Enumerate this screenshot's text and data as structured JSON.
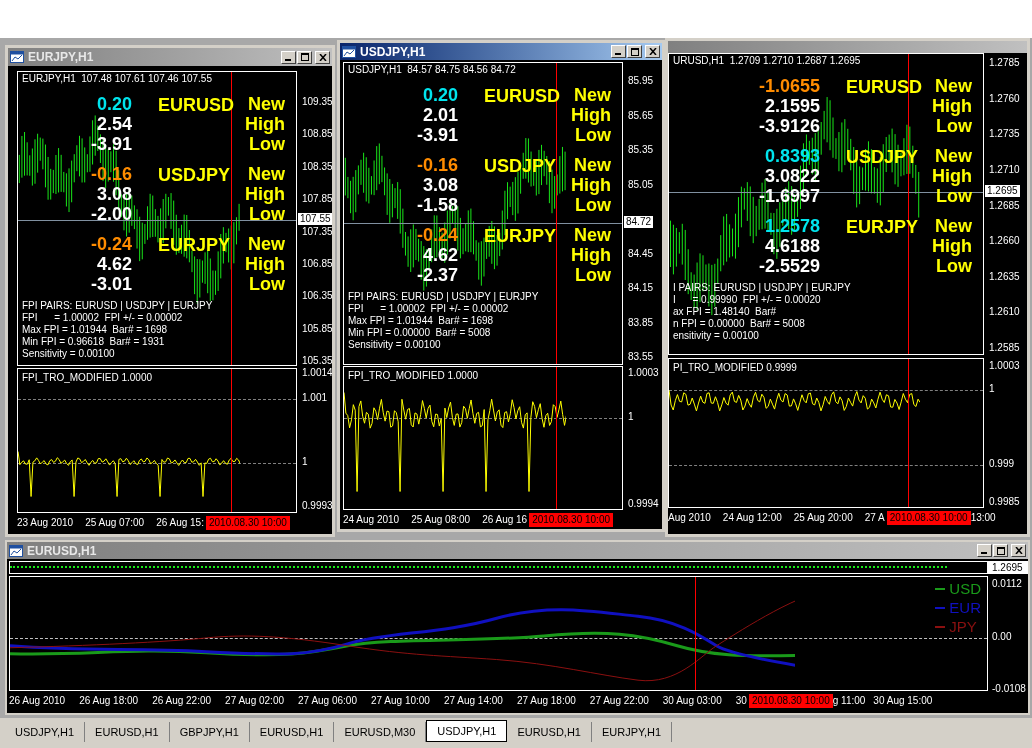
{
  "windows": [
    {
      "title": "EURJPY,H1",
      "active": false,
      "header": "EURJPY,H1  107.48 107.61 107.46 107.55",
      "groups": [
        {
          "pair": "EURUSD",
          "color": "#00e5ee",
          "values": [
            "0.20",
            "2.54",
            "-3.91"
          ],
          "labels": [
            "New",
            "High",
            "Low"
          ]
        },
        {
          "pair": "USDJPY",
          "color": "#ff8c00",
          "values": [
            "-0.16",
            "3.08",
            "-2.00"
          ],
          "labels": [
            "New",
            "High",
            "Low"
          ]
        },
        {
          "pair": "EURJPY",
          "color": "#ff8c00",
          "values": [
            "-0.24",
            "4.62",
            "-3.01"
          ],
          "labels": [
            "New",
            "High",
            "Low"
          ]
        }
      ],
      "info_lines": [
        "FPI PAIRS: EURUSD | USDJPY | EURJPY",
        "FPI      = 1.00002  FPI +/- = 0.00002",
        "Max FPI = 1.01944  Bar# = 1698",
        "Min FPI = 0.96618  Bar# = 1931",
        "Sensitivity = 0.00100"
      ],
      "price_ticks": [
        "109.35",
        "108.85",
        "108.35",
        "107.85",
        "107.35",
        "106.85",
        "106.35",
        "105.85",
        "105.35"
      ],
      "current_price": "107.55",
      "indicator": {
        "title": "FPI_TRO_MODIFIED 1.0000",
        "ticks": [
          "1.0014",
          "1.001",
          "1",
          "0.9993"
        ]
      },
      "time_labels": [
        "23 Aug 2010",
        "25 Aug 07:00",
        "26 Aug 15:"
      ],
      "cursor_time": "2010.08.30 10:00"
    },
    {
      "title": "USDJPY,H1",
      "active": true,
      "header": "USDJPY,H1  84.57 84.75 84.56 84.72",
      "groups": [
        {
          "pair": "EURUSD",
          "color": "#00e5ee",
          "values": [
            "0.20",
            "2.01",
            "-3.91"
          ],
          "labels": [
            "New",
            "High",
            "Low"
          ]
        },
        {
          "pair": "USDJPY",
          "color": "#ff8c00",
          "values": [
            "-0.16",
            "3.08",
            "-1.58"
          ],
          "labels": [
            "New",
            "High",
            "Low"
          ]
        },
        {
          "pair": "EURJPY",
          "color": "#ff8c00",
          "values": [
            "-0.24",
            "4.62",
            "-2.37"
          ],
          "labels": [
            "New",
            "High",
            "Low"
          ]
        }
      ],
      "info_lines": [
        "FPI PAIRS: EURUSD | USDJPY | EURJPY",
        "FPI      = 1.00002  FPI +/- = 0.00002",
        "Max FPI = 1.01944  Bar# = 1698",
        "Min FPI = 0.00000  Bar# = 5008",
        "Sensitivity = 0.00100"
      ],
      "price_ticks": [
        "85.95",
        "85.65",
        "85.35",
        "85.05",
        "84.45",
        "84.15",
        "83.85",
        "83.55"
      ],
      "current_price": "84.72",
      "indicator": {
        "title": "FPI_TRO_MODIFIED 1.0000",
        "ticks": [
          "1.0003",
          "1",
          "0.9994"
        ]
      },
      "time_labels": [
        "24 Aug 2010",
        "25 Aug 08:00",
        "26 Aug 16"
      ],
      "cursor_time": "2010.08.30 10:00"
    },
    {
      "active": false,
      "header": "URUSD,H1  1.2709 1.2710 1.2687 1.2695",
      "groups": [
        {
          "pair": "EURUSD",
          "color": "#ff8c00",
          "values": [
            "-1.0655",
            "2.1595",
            "-3.9126"
          ],
          "labels": [
            "New",
            "High",
            "Low"
          ]
        },
        {
          "pair": "USDJPY",
          "color": "#00e5ee",
          "values": [
            "0.8393",
            "3.0822",
            "-1.6997"
          ],
          "labels": [
            "New",
            "High",
            "Low"
          ]
        },
        {
          "pair": "EURJPY",
          "color": "#00e5ee",
          "values": [
            "1.2578",
            "4.6188",
            "-2.5529"
          ],
          "labels": [
            "New",
            "High",
            "Low"
          ]
        }
      ],
      "info_lines": [
        "I PAIRS: EURUSD | USDJPY | EURJPY",
        "I      = 0.99990  FPI +/- = 0.00020",
        "ax FPI = 1.48140  Bar#",
        "n FPI = 0.00000  Bar# = 5008",
        "ensitivity = 0.00100"
      ],
      "price_ticks": [
        "1.2785",
        "1.2760",
        "1.2735",
        "1.2710",
        "1.2685",
        "1.2660",
        "1.2635",
        "1.2610",
        "1.2585"
      ],
      "current_price": "1.2695",
      "indicator": {
        "title": "PI_TRO_MODIFIED 0.9999",
        "ticks": [
          "1.0003",
          "1",
          "0.999",
          "0.9985"
        ]
      },
      "time_labels": [
        "Aug 2010",
        "24 Aug 12:00",
        "25 Aug 20:00",
        "27 A"
      ],
      "cursor_time": "2010.08.30 10:00",
      "time_after": [
        "13:00"
      ]
    }
  ],
  "strength_window": {
    "title": "EURUSD,H1",
    "mini_price": "1.2695",
    "legend": [
      {
        "label": "USD",
        "color": "#1a9a1a"
      },
      {
        "label": "EUR",
        "color": "#1010c0"
      },
      {
        "label": "JPY",
        "color": "#8b1010"
      }
    ],
    "ticks": [
      "0.0112",
      "0.00",
      "-0.0108"
    ],
    "time_labels": [
      "26 Aug 2010",
      "26 Aug 18:00",
      "26 Aug 22:00",
      "27 Aug 02:00",
      "27 Aug 06:00",
      "27 Aug 10:00",
      "27 Aug 14:00",
      "27 Aug 18:00",
      "27 Aug 22:00",
      "30 Aug 03:00",
      "30"
    ],
    "cursor_time": "2010.08.30 10:00",
    "time_after": [
      "g 11:00",
      "30 Aug 15:00"
    ]
  },
  "tabs": [
    {
      "label": "USDJPY,H1",
      "selected": false
    },
    {
      "label": "EURUSD,H1",
      "selected": false
    },
    {
      "label": "GBPJPY,H1",
      "selected": false
    },
    {
      "label": "EURUSD,H1",
      "selected": false
    },
    {
      "label": "EURUSD,M30",
      "selected": false
    },
    {
      "label": "USDJPY,H1",
      "selected": true
    },
    {
      "label": "EURUSD,H1",
      "selected": false
    },
    {
      "label": "EURJPY,H1",
      "selected": false
    }
  ]
}
